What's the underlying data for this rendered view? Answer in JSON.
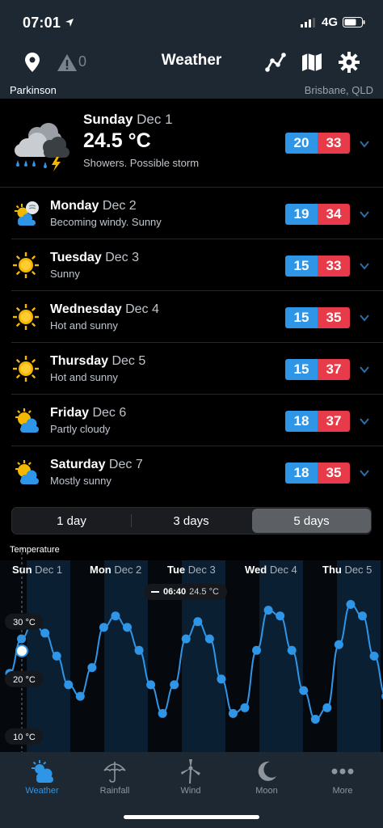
{
  "status": {
    "time": "07:01",
    "network": "4G"
  },
  "nav": {
    "title": "Weather",
    "warning_count": "0"
  },
  "location": {
    "suburb": "Parkinson",
    "region": "Brisbane, QLD"
  },
  "today": {
    "day": "Sunday",
    "date": "Dec 1",
    "temp": "24.5 °C",
    "desc": "Showers. Possible storm",
    "min": "20",
    "max": "33",
    "icon": "storm-cloud-icon"
  },
  "forecast": [
    {
      "day": "Monday",
      "date": "Dec 2",
      "desc": "Becoming windy. Sunny",
      "min": "19",
      "max": "34",
      "icon": "windy-partly-cloudy-icon"
    },
    {
      "day": "Tuesday",
      "date": "Dec 3",
      "desc": "Sunny",
      "min": "15",
      "max": "33",
      "icon": "sun-icon"
    },
    {
      "day": "Wednesday",
      "date": "Dec 4",
      "desc": "Hot and sunny",
      "min": "15",
      "max": "35",
      "icon": "sun-icon"
    },
    {
      "day": "Thursday",
      "date": "Dec 5",
      "desc": "Hot and sunny",
      "min": "15",
      "max": "37",
      "icon": "sun-icon"
    },
    {
      "day": "Friday",
      "date": "Dec 6",
      "desc": "Partly cloudy",
      "min": "18",
      "max": "37",
      "icon": "partly-cloudy-icon"
    },
    {
      "day": "Saturday",
      "date": "Dec 7",
      "desc": "Mostly sunny",
      "min": "18",
      "max": "35",
      "icon": "partly-cloudy-icon"
    }
  ],
  "range_tabs": [
    "1 day",
    "3 days",
    "5 days"
  ],
  "range_selected": "5 days",
  "chart_data": {
    "type": "line",
    "title": "Temperature",
    "series": [
      {
        "values": [
          21,
          27,
          30,
          28,
          24,
          19,
          17,
          22,
          29,
          31,
          29,
          25,
          19,
          14,
          19,
          27,
          30,
          27,
          20,
          14,
          15,
          25,
          32,
          31,
          25,
          18,
          13,
          15,
          26,
          33,
          31,
          24,
          17
        ]
      }
    ],
    "x_range": [
      0,
      4.85
    ],
    "ylim": [
      8,
      38
    ],
    "y_ticks": [
      "30 °C",
      "20 °C",
      "10 °C"
    ],
    "day_labels": [
      {
        "day": "Sun",
        "date": "Dec 1"
      },
      {
        "day": "Mon",
        "date": "Dec 2"
      },
      {
        "day": "Tue",
        "date": "Dec 3"
      },
      {
        "day": "Wed",
        "date": "Dec 4"
      },
      {
        "day": "Thu",
        "date": "Dec 5"
      }
    ],
    "tooltip": {
      "time": "06:40",
      "value": "24.5 °C"
    },
    "colors": {
      "line": "#2f95e6",
      "day_band": "#0b1f33",
      "night_band": "#05090e"
    }
  },
  "tabs": [
    {
      "label": "Weather",
      "icon": "weather-icon",
      "active": true
    },
    {
      "label": "Rainfall",
      "icon": "umbrella-icon",
      "active": false
    },
    {
      "label": "Wind",
      "icon": "wind-turbine-icon",
      "active": false
    },
    {
      "label": "Moon",
      "icon": "moon-icon",
      "active": false
    },
    {
      "label": "More",
      "icon": "more-icon",
      "active": false
    }
  ]
}
